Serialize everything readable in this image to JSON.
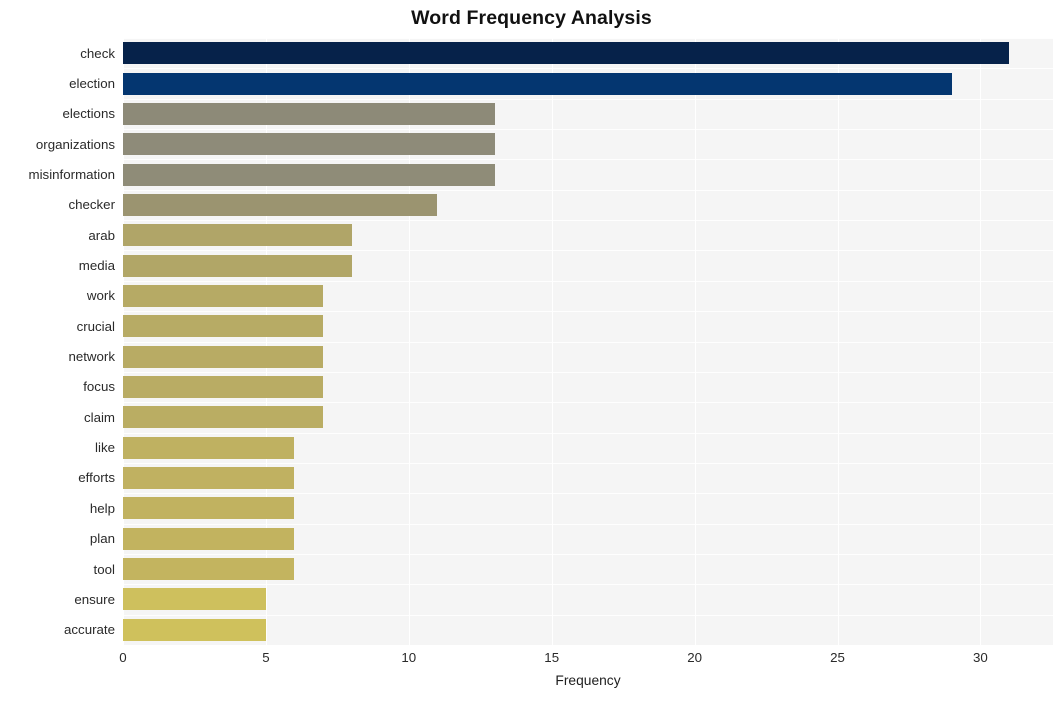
{
  "chart_data": {
    "type": "bar",
    "orientation": "horizontal",
    "title": "Word Frequency Analysis",
    "xlabel": "Frequency",
    "ylabel": "",
    "xlim": [
      0,
      32.54
    ],
    "xticks": [
      0,
      5,
      10,
      15,
      20,
      25,
      30
    ],
    "xtick_labels": [
      "0",
      "5",
      "10",
      "15",
      "20",
      "25",
      "30"
    ],
    "grid": true,
    "grid_color": "#ffffff",
    "plot_background": "#f5f5f5",
    "legend": "none",
    "categories": [
      "check",
      "election",
      "elections",
      "organizations",
      "misinformation",
      "checker",
      "arab",
      "media",
      "work",
      "crucial",
      "network",
      "focus",
      "claim",
      "like",
      "efforts",
      "help",
      "plan",
      "tool",
      "ensure",
      "accurate"
    ],
    "values": [
      31,
      29,
      13,
      13,
      13,
      11,
      8,
      8,
      7,
      7,
      7,
      7,
      7,
      6,
      6,
      6,
      6,
      6,
      5,
      5
    ],
    "bar_colors": [
      "#06224a",
      "#043670",
      "#8d8a78",
      "#8e8b79",
      "#8f8c78",
      "#9b9470",
      "#b0a568",
      "#b1a667",
      "#b6aa65",
      "#b7ab65",
      "#b8ab64",
      "#b9ac64",
      "#baad63",
      "#bfb161",
      "#c0b161",
      "#c1b260",
      "#c2b35f",
      "#c3b45f",
      "#cec05d",
      "#cfc15c"
    ]
  },
  "axis": {
    "x_title": "Frequency"
  }
}
